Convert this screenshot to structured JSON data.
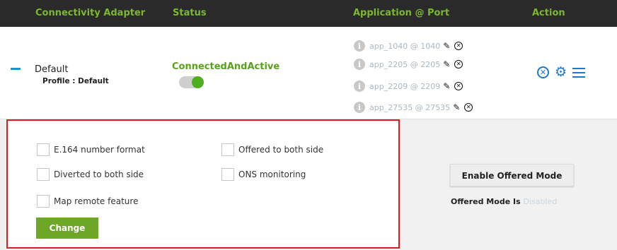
{
  "table": {
    "headers": [
      "Connectivity Adapter",
      "Status",
      "Application @ Port",
      "Action"
    ],
    "row": {
      "adapter": "Default",
      "profile": "Profile : Default",
      "status": "ConnectedAndActive",
      "toggle_on": true,
      "applications": [
        "app_1040 @ 1040",
        "app_2205 @ 2205",
        "app_2209 @ 2209",
        "app_27535 @ 27535"
      ],
      "icons": {
        "info": "info-icon",
        "edit": "pencil-icon",
        "remove": "close-circle-icon"
      }
    },
    "actions": [
      "close-circle-icon",
      "gear-icon",
      "menu-icon"
    ]
  },
  "options": {
    "checkboxes": [
      {
        "label": "E.164 number format",
        "checked": false
      },
      {
        "label": "Offered to both side",
        "checked": false
      },
      {
        "label": "Diverted to both side",
        "checked": false
      },
      {
        "label": "ONS monitoring",
        "checked": false
      },
      {
        "label": "Map remote feature",
        "checked": false
      }
    ],
    "change_label": "Change"
  },
  "offered": {
    "button_label": "Enable Offered Mode",
    "status_prefix": "Offered Mode Is ",
    "status_value": "Disabled"
  },
  "colors": {
    "header_bg": "#2a2a2a",
    "header_text": "#7cb82f",
    "accent_blue": "#1f78d0",
    "green": "#6ea628",
    "highlight_border": "#e0191b"
  }
}
